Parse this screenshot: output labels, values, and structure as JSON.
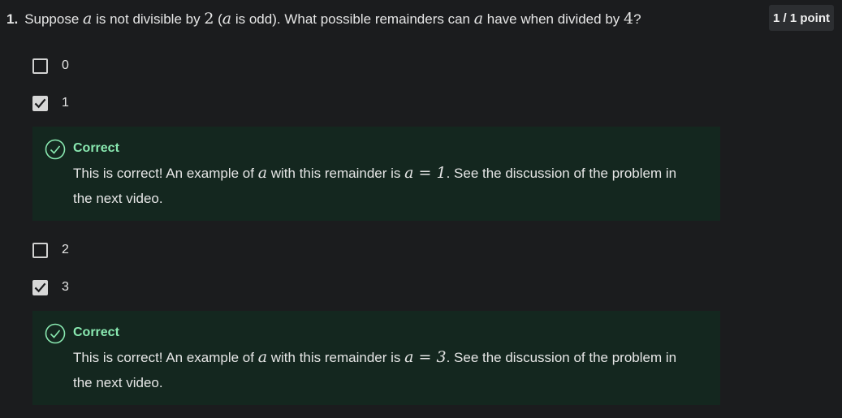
{
  "question": {
    "number": "1.",
    "parts": {
      "t1": "Suppose ",
      "m1": "a",
      "t2": " is not divisible by ",
      "m2": "2",
      "t3": " (",
      "m3": "a",
      "t4": " is odd). What possible remainders can ",
      "m4": "a",
      "t5": " have when divided by ",
      "m5": "4",
      "t6": "?"
    }
  },
  "points": "1 / 1 point",
  "options": [
    {
      "label": "0",
      "checked": false
    },
    {
      "label": "1",
      "checked": true
    },
    {
      "label": "2",
      "checked": false
    },
    {
      "label": "3",
      "checked": true
    }
  ],
  "feedback": [
    {
      "title": "Correct",
      "t1": "This is correct! An example of ",
      "m1": "a",
      "t2": " with this remainder is ",
      "m2": "a = 1",
      "t3": ". See the discussion of the problem in the next video."
    },
    {
      "title": "Correct",
      "t1": "This is correct! An example of ",
      "m1": "a",
      "t2": " with this remainder is ",
      "m2": "a = 3",
      "t3": ". See the discussion of the problem in the next video."
    }
  ],
  "colors": {
    "background": "#1b1c1e",
    "feedback_bg": "#14271f",
    "correct_green": "#89e8b0",
    "checkbox": "#d7d7d7"
  },
  "icons": {
    "checkbox_checked": "check-icon",
    "feedback": "check-circle-icon"
  }
}
